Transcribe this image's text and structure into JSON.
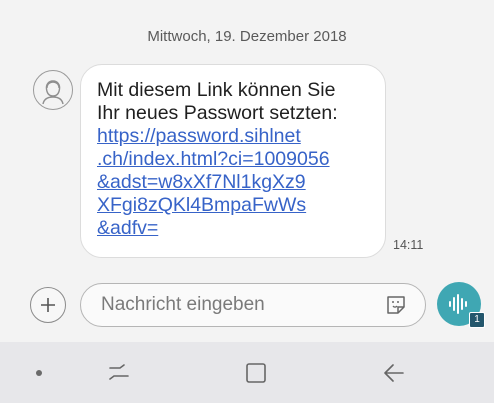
{
  "conversation": {
    "date": "Mittwoch, 19. Dezember 2018",
    "messages": [
      {
        "line1": "Mit diesem Link können Sie",
        "line2": "Ihr neues Passwort setzten:",
        "link_lines": [
          "https://password.sihlnet",
          ".ch/index.html?ci=1009056",
          "&adst=w8xXf7Nl1kgXz9",
          "XFgi8zQKl4BmpaFwWs",
          "&adfv="
        ],
        "time": "14:11"
      }
    ]
  },
  "composer": {
    "placeholder": "Nachricht eingeben",
    "sim_badge": "1"
  },
  "icons": {
    "avatar": "person-avatar-icon",
    "add": "plus-icon",
    "sticker": "sticker-icon",
    "send": "voice-wave-icon",
    "nav": [
      "dot-icon",
      "recent-apps-icon",
      "home-icon",
      "back-icon"
    ]
  },
  "colors": {
    "link": "#3763c8",
    "send_button": "#3fa7b3",
    "badge": "#23566c"
  }
}
